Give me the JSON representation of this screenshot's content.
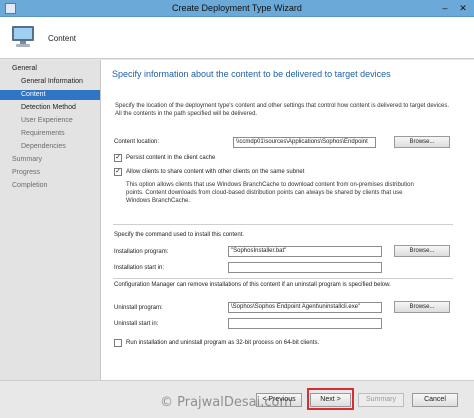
{
  "window": {
    "title": "Create Deployment Type Wizard",
    "minimize_glyph": "–",
    "close_glyph": "✕",
    "icon": "wizard-app-icon"
  },
  "header": {
    "title": "Content",
    "icon": "computer-icon"
  },
  "nav": {
    "items": [
      {
        "label": "General",
        "level": 0,
        "state": "normal"
      },
      {
        "label": "General Information",
        "level": 1,
        "state": "normal"
      },
      {
        "label": "Content",
        "level": 1,
        "state": "active"
      },
      {
        "label": "Detection Method",
        "level": 1,
        "state": "normal"
      },
      {
        "label": "User Experience",
        "level": 1,
        "state": "dim"
      },
      {
        "label": "Requirements",
        "level": 1,
        "state": "dim"
      },
      {
        "label": "Dependencies",
        "level": 1,
        "state": "dim"
      },
      {
        "label": "Summary",
        "level": 0,
        "state": "dim"
      },
      {
        "label": "Progress",
        "level": 0,
        "state": "dim"
      },
      {
        "label": "Completion",
        "level": 0,
        "state": "dim"
      }
    ]
  },
  "content": {
    "title": "Specify information about the content to be delivered to target devices",
    "description": "Specify the location of the deployment type's content and other settings that control how content is delivered to target devices. All the contents in the path specified will be delivered.",
    "content_location_label": "Content location:",
    "content_location_value": "\\\\ccmdp01\\sources\\Applications\\Sophos\\Endpoint",
    "browse_label": "Browse...",
    "persist_label": "Persist content in the client cache",
    "persist_checked": true,
    "allow_share_label": "Allow clients to share content with other clients on the same subnet",
    "allow_share_checked": true,
    "branchcache_note": "This option allows clients that use Windows BranchCache to download content from on-premises distribution points. Content downloads from cloud-based distribution points can always be shared by clients that use Windows BranchCache.",
    "command_intro": "Specify the command used to install this content.",
    "install_program_label": "Installation program:",
    "install_program_value": "\"SophosInstaller.bat\"",
    "install_start_label": "Installation start in:",
    "install_start_value": "",
    "uninstall_intro": "Configuration Manager can remove installations of this content if an uninstall program is specified below.",
    "uninstall_program_label": "Uninstall program:",
    "uninstall_program_value": "\\Sophos\\Sophos Endpoint Agent\\uninstallcli.exe\"",
    "uninstall_start_label": "Uninstall start in:",
    "uninstall_start_value": "",
    "run_32bit_label": "Run installation and uninstall program as 32-bit process on 64-bit clients.",
    "run_32bit_checked": false,
    "check_glyph": "✓"
  },
  "footer": {
    "previous_label": "< Previous",
    "next_label": "Next >",
    "summary_label": "Summary",
    "cancel_label": "Cancel",
    "highlight_color": "#d5302f"
  },
  "watermark": "© PrajwalDesai.com",
  "colors": {
    "accent": "#2e76c4",
    "title_blue": "#1f5fa8",
    "titlebar": "#6aa9d8"
  }
}
